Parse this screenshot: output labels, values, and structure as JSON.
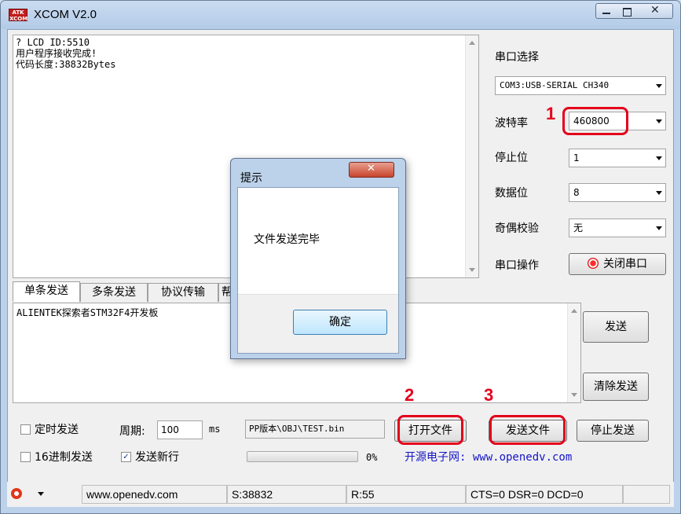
{
  "window": {
    "title": "XCOM V2.0",
    "logo_text": "ATK XCOM"
  },
  "receive": {
    "lines": [
      "? LCD ID:5510",
      "用户程序接收完成!",
      "代码长度:38832Bytes"
    ]
  },
  "serial": {
    "port_label": "串口选择",
    "port_value": "COM3:USB-SERIAL CH340",
    "baud_label": "波特率",
    "baud_value": "460800",
    "stop_label": "停止位",
    "stop_value": "1",
    "data_label": "数据位",
    "data_value": "8",
    "parity_label": "奇偶校验",
    "parity_value": "无",
    "op_label": "串口操作",
    "op_button": "关闭串口"
  },
  "tabs": [
    "单条发送",
    "多条发送",
    "协议传输",
    "帮"
  ],
  "send": {
    "text": "ALIENTEK探索者STM32F4开发板",
    "send_button": "发送",
    "clear_button": "清除发送",
    "timed_label": "定时发送",
    "period_label": "周期:",
    "period_value": "100",
    "period_unit": "ms",
    "file_path": "PP版本\\OBJ\\TEST.bin",
    "open_file_button": "打开文件",
    "send_file_button": "发送文件",
    "stop_send_button": "停止发送",
    "hex_label": "16进制发送",
    "newline_label": "发送新行",
    "newline_checked": true,
    "progress_percent": 0,
    "progress_text": "0%",
    "site_label": "开源电子网: www.openedv.com"
  },
  "annotations": [
    "1",
    "2",
    "3"
  ],
  "status": {
    "url": "www.openedv.com",
    "sent": "S:38832",
    "received": "R:55",
    "lines": "CTS=0 DSR=0 DCD=0"
  },
  "dialog": {
    "title": "提示",
    "message": "文件发送完毕",
    "ok_button": "确定"
  },
  "colors": {
    "annotation_red": "#e3001b",
    "site_blue": "#1515c8"
  }
}
